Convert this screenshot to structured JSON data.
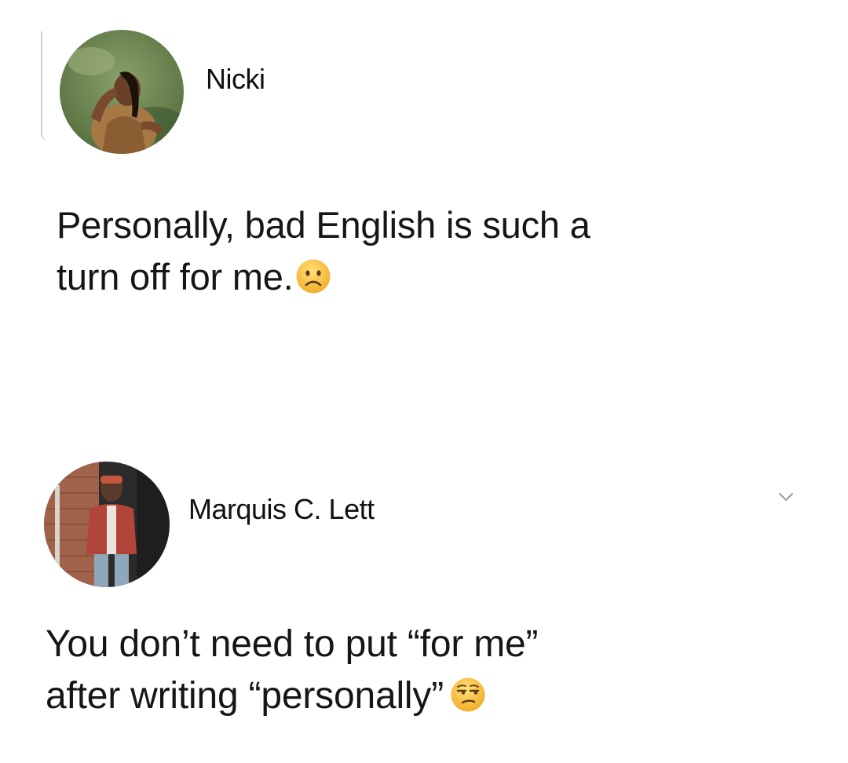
{
  "posts": [
    {
      "author": "Nicki",
      "avatar_icon": "profile-photo",
      "lines": [
        "Personally, bad English is such a",
        "turn off for me."
      ],
      "emoji_icon": "frowning-face-emoji"
    },
    {
      "author": "Marquis C. Lett",
      "avatar_icon": "profile-photo",
      "menu_icon": "chevron-down-icon",
      "lines": [
        "You don’t need to put “for me”",
        "after writing “personally”"
      ],
      "emoji_icon": "unamused-face-emoji"
    }
  ],
  "colors": {
    "background": "#ffffff",
    "text": "#161616",
    "emoji_yellow": "#f7c23a",
    "chevron": "#9a9a9a"
  }
}
